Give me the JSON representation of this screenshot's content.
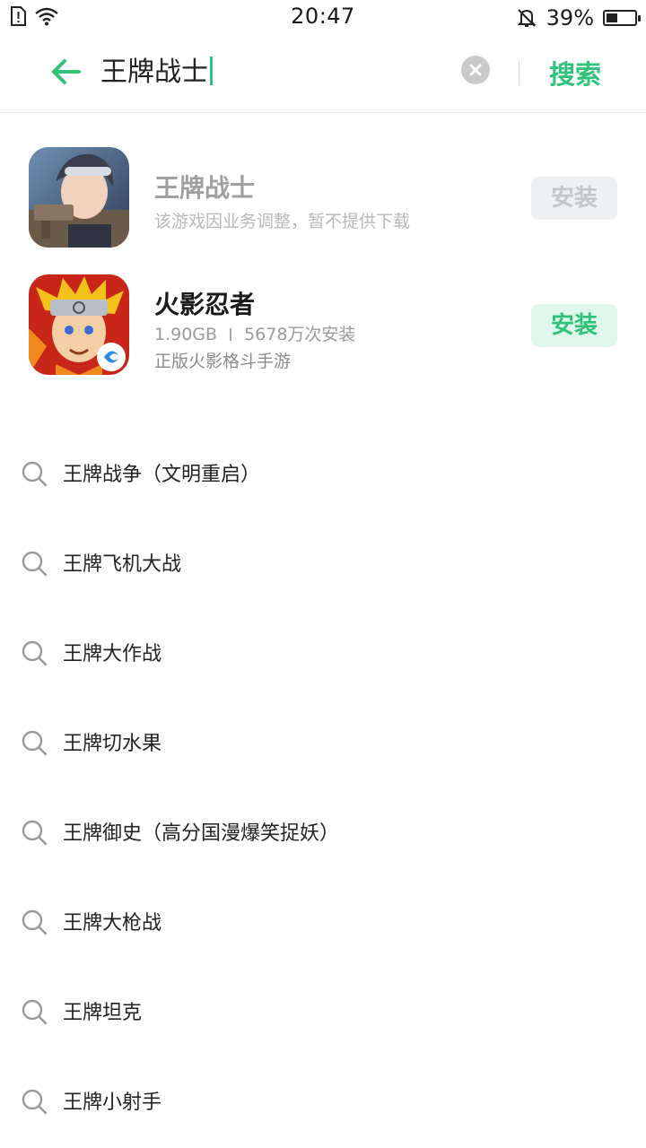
{
  "status_bar": {
    "time": "20:47",
    "battery_percent_text": "39%",
    "battery_level": 0.39
  },
  "search": {
    "query": "王牌战士",
    "search_label": "搜索"
  },
  "results": [
    {
      "name": "王牌战士",
      "note": "该游戏因业务调整，暂不提供下载",
      "install_label": "安装",
      "available": false
    },
    {
      "name": "火影忍者",
      "size": "1.90GB",
      "installs": "5678万次安装",
      "description": "正版火影格斗手游",
      "install_label": "安装",
      "available": true
    }
  ],
  "suggestions": [
    "王牌战争（文明重启）",
    "王牌飞机大战",
    "王牌大作战",
    "王牌切水果",
    "王牌御史（高分国漫爆笑捉妖）",
    "王牌大枪战",
    "王牌坦克",
    "王牌小射手"
  ],
  "colors": {
    "accent": "#2fc27a",
    "install_active_bg": "#dff7ea",
    "install_disabled_bg": "#eef0f2"
  }
}
